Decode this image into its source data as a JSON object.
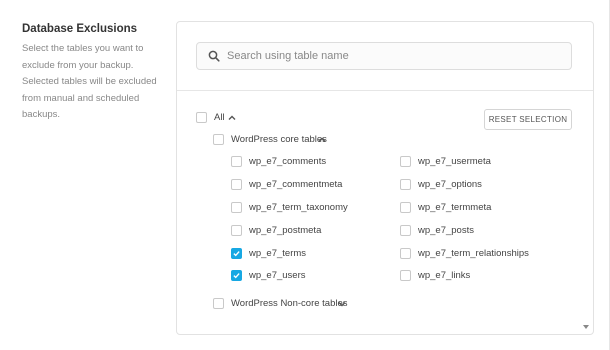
{
  "section": {
    "title": "Database Exclusions",
    "description": "Select the tables you want to exclude from your backup. Selected tables will be excluded from manual and scheduled backups."
  },
  "search": {
    "placeholder": "Search using table name",
    "value": ""
  },
  "reset_label": "RESET SELECTION",
  "all": {
    "label": "All",
    "checked": false,
    "icon": "chevron-up-icon"
  },
  "core": {
    "label": "WordPress core tables",
    "checked": false,
    "icon": "chevron-up-icon"
  },
  "tables": [
    {
      "label": "wp_e7_comments",
      "checked": false
    },
    {
      "label": "wp_e7_usermeta",
      "checked": false
    },
    {
      "label": "wp_e7_commentmeta",
      "checked": false
    },
    {
      "label": "wp_e7_options",
      "checked": false
    },
    {
      "label": "wp_e7_term_taxonomy",
      "checked": false
    },
    {
      "label": "wp_e7_termmeta",
      "checked": false
    },
    {
      "label": "wp_e7_postmeta",
      "checked": false
    },
    {
      "label": "wp_e7_posts",
      "checked": false
    },
    {
      "label": "wp_e7_terms",
      "checked": true
    },
    {
      "label": "wp_e7_term_relationships",
      "checked": false
    },
    {
      "label": "wp_e7_users",
      "checked": true
    },
    {
      "label": "wp_e7_links",
      "checked": false
    }
  ],
  "noncore": {
    "label": "WordPress Non-core tables",
    "checked": false,
    "icon": "chevron-down-icon"
  },
  "colors": {
    "accent": "#17a8e3",
    "border": "#e2e2e2",
    "muted_text": "#888888"
  }
}
